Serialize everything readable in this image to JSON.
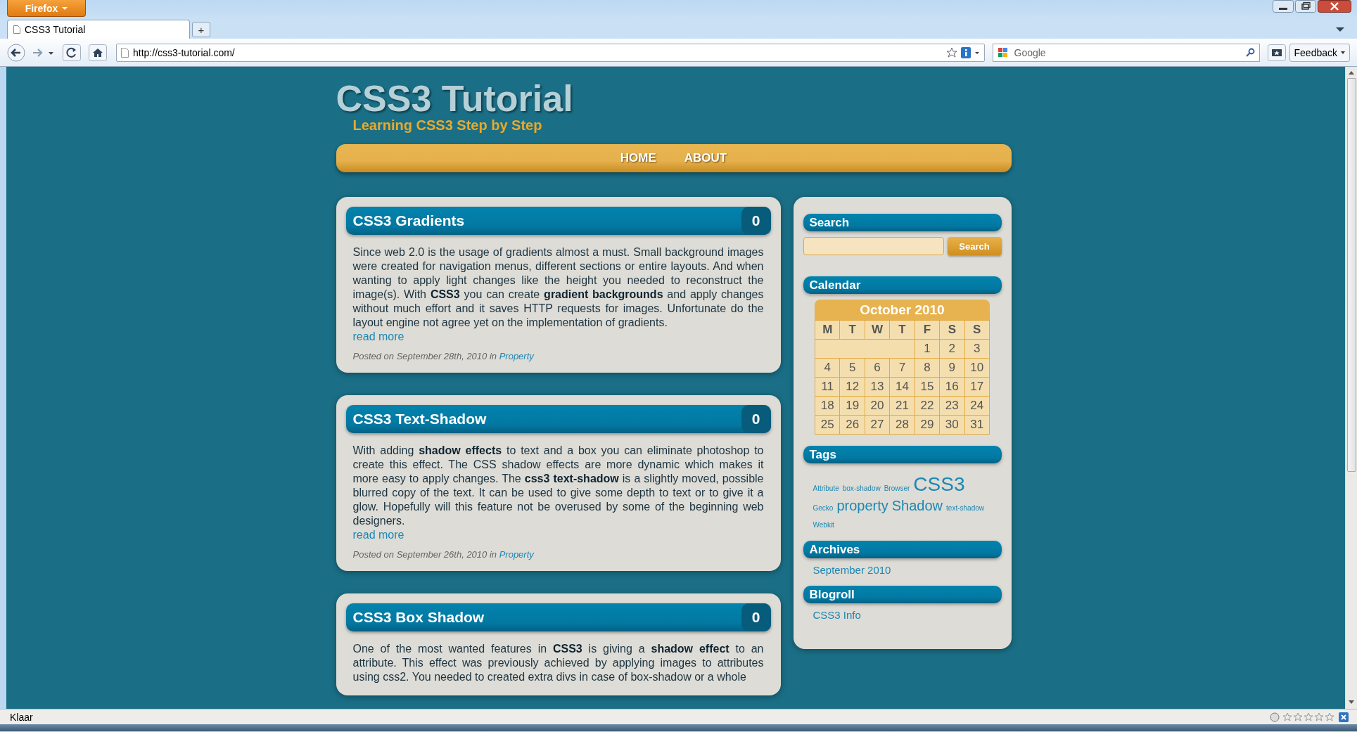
{
  "browser": {
    "menu_button": "Firefox",
    "tabs": [
      {
        "label": "CSS3 Tutorial",
        "selected": true
      }
    ],
    "new_tab": "+",
    "address": "http://css3-tutorial.com/",
    "search_placeholder": "Google",
    "feedback": "Feedback",
    "status": "Klaar"
  },
  "site": {
    "title": "CSS3 Tutorial",
    "tagline": "Learning CSS3 Step by Step",
    "nav": [
      {
        "label": "HOME"
      },
      {
        "label": "ABOUT"
      }
    ],
    "posts": [
      {
        "title": "CSS3 Gradients",
        "comments": "0",
        "body": "Since web 2.0 is the usage of gradients almost a must. Small background images were created for navigation menus, different sections or entire layouts. And when wanting to apply light changes like the height you needed to reconstruct the image(s). With **CSS3** you can create **gradient backgrounds** and apply changes without much effort and it saves HTTP requests for images. Unfortunate do the layout engine not agree yet on the implementation of gradients.",
        "read_more": "read more",
        "meta": "Posted on September 28th, 2010 in",
        "category": "Property"
      },
      {
        "title": "CSS3 Text-Shadow",
        "comments": "0",
        "body": "With adding **shadow effects** to text and a box you can eliminate photoshop to create this effect. The CSS shadow effects are more dynamic which makes it more easy to apply changes. The **css3 text-shadow** is a slightly moved, possible blurred copy of the text. It can be used to give some depth to text or to give it a  glow. Hopefully will this feature not be overused by some of the beginning  web designers.",
        "read_more": "read more",
        "meta": "Posted on September 26th, 2010 in",
        "category": "Property"
      },
      {
        "title": "CSS3 Box Shadow",
        "comments": "0",
        "body": "One of the most wanted features in **CSS3** is giving a **shadow effect** to an attribute. This effect was previously achieved by applying images to attributes using css2. You needed to created extra divs in case of box-shadow or a whole"
      }
    ],
    "sidebar": {
      "search": {
        "heading": "Search",
        "button": "Search"
      },
      "calendar": {
        "heading": "Calendar",
        "month": "October 2010",
        "weekdays": [
          "M",
          "T",
          "W",
          "T",
          "F",
          "S",
          "S"
        ],
        "weeks": [
          [
            "1",
            "2",
            "3"
          ],
          [
            "4",
            "5",
            "6",
            "7",
            "8",
            "9",
            "10"
          ],
          [
            "11",
            "12",
            "13",
            "14",
            "15",
            "16",
            "17"
          ],
          [
            "18",
            "19",
            "20",
            "21",
            "22",
            "23",
            "24"
          ],
          [
            "25",
            "26",
            "27",
            "28",
            "29",
            "30",
            "31"
          ]
        ]
      },
      "tags": {
        "heading": "Tags",
        "items": [
          {
            "label": "Attribute",
            "kind": "small"
          },
          {
            "label": "box-shadow",
            "kind": "small"
          },
          {
            "label": "Browser",
            "kind": "small"
          },
          {
            "label": "CSS3",
            "kind": "large"
          },
          {
            "label": "Gecko",
            "kind": "small"
          },
          {
            "label": "property",
            "kind": "medium"
          },
          {
            "label": "Shadow",
            "kind": "medium"
          },
          {
            "label": "text-shadow",
            "kind": "small"
          },
          {
            "label": "Webkit",
            "kind": "small"
          }
        ]
      },
      "archives": {
        "heading": "Archives",
        "links": [
          "September 2010"
        ]
      },
      "blogroll": {
        "heading": "Blogroll",
        "links": [
          "CSS3 Info"
        ]
      }
    }
  }
}
